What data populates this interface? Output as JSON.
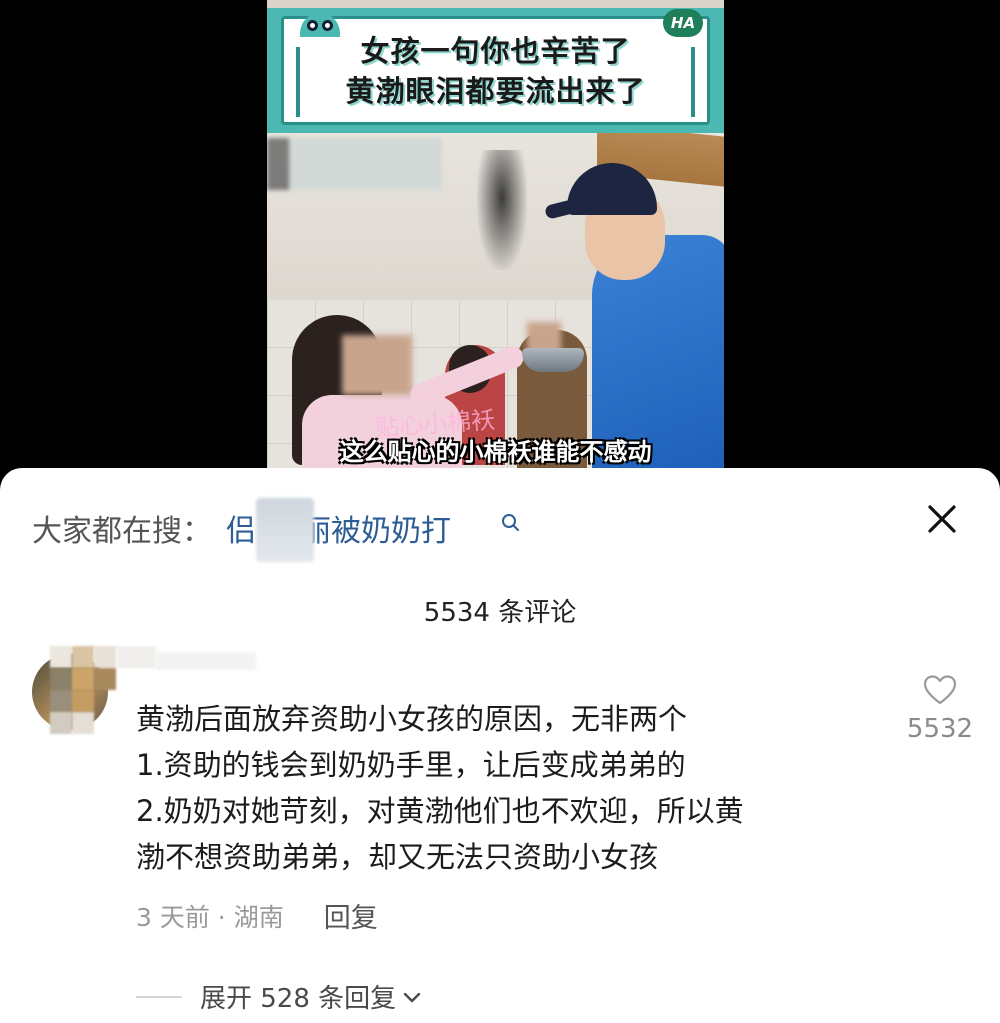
{
  "video": {
    "banner_line1": "女孩一句你也辛苦了",
    "banner_line2": "黄渤眼泪都要流出来了",
    "banner_badge": "HA",
    "subtitle": "这么贴心的小棉袄谁能不感动",
    "ghost_text": "贴心小棉袄"
  },
  "search": {
    "prefix": "大家都在搜：",
    "term_visible": "丽被奶奶打",
    "term_lead": "侣"
  },
  "comments_header": {
    "count_label": "5534 条评论"
  },
  "comment": {
    "lines": [
      "黄渤后面放弃资助小女孩的原因，无非两个",
      "1.资助的钱会到奶奶手里，让后变成弟弟的",
      "2.奶奶对她苛刻，对黄渤他们也不欢迎，所以黄",
      "渤不想资助弟弟，却又无法只资助小女孩"
    ],
    "time_location": "3 天前 · 湖南",
    "reply_label": "回复",
    "like_count": "5532",
    "expand_label": "展开 528 条回复"
  },
  "icons": {
    "search": "search-icon",
    "close": "close-icon",
    "like": "heart-outline-icon",
    "expand": "chevron-down-icon"
  },
  "colors": {
    "banner_teal": "#4cb8b2",
    "link_blue": "#2c5d95",
    "muted_gray": "#9a9a9a"
  }
}
